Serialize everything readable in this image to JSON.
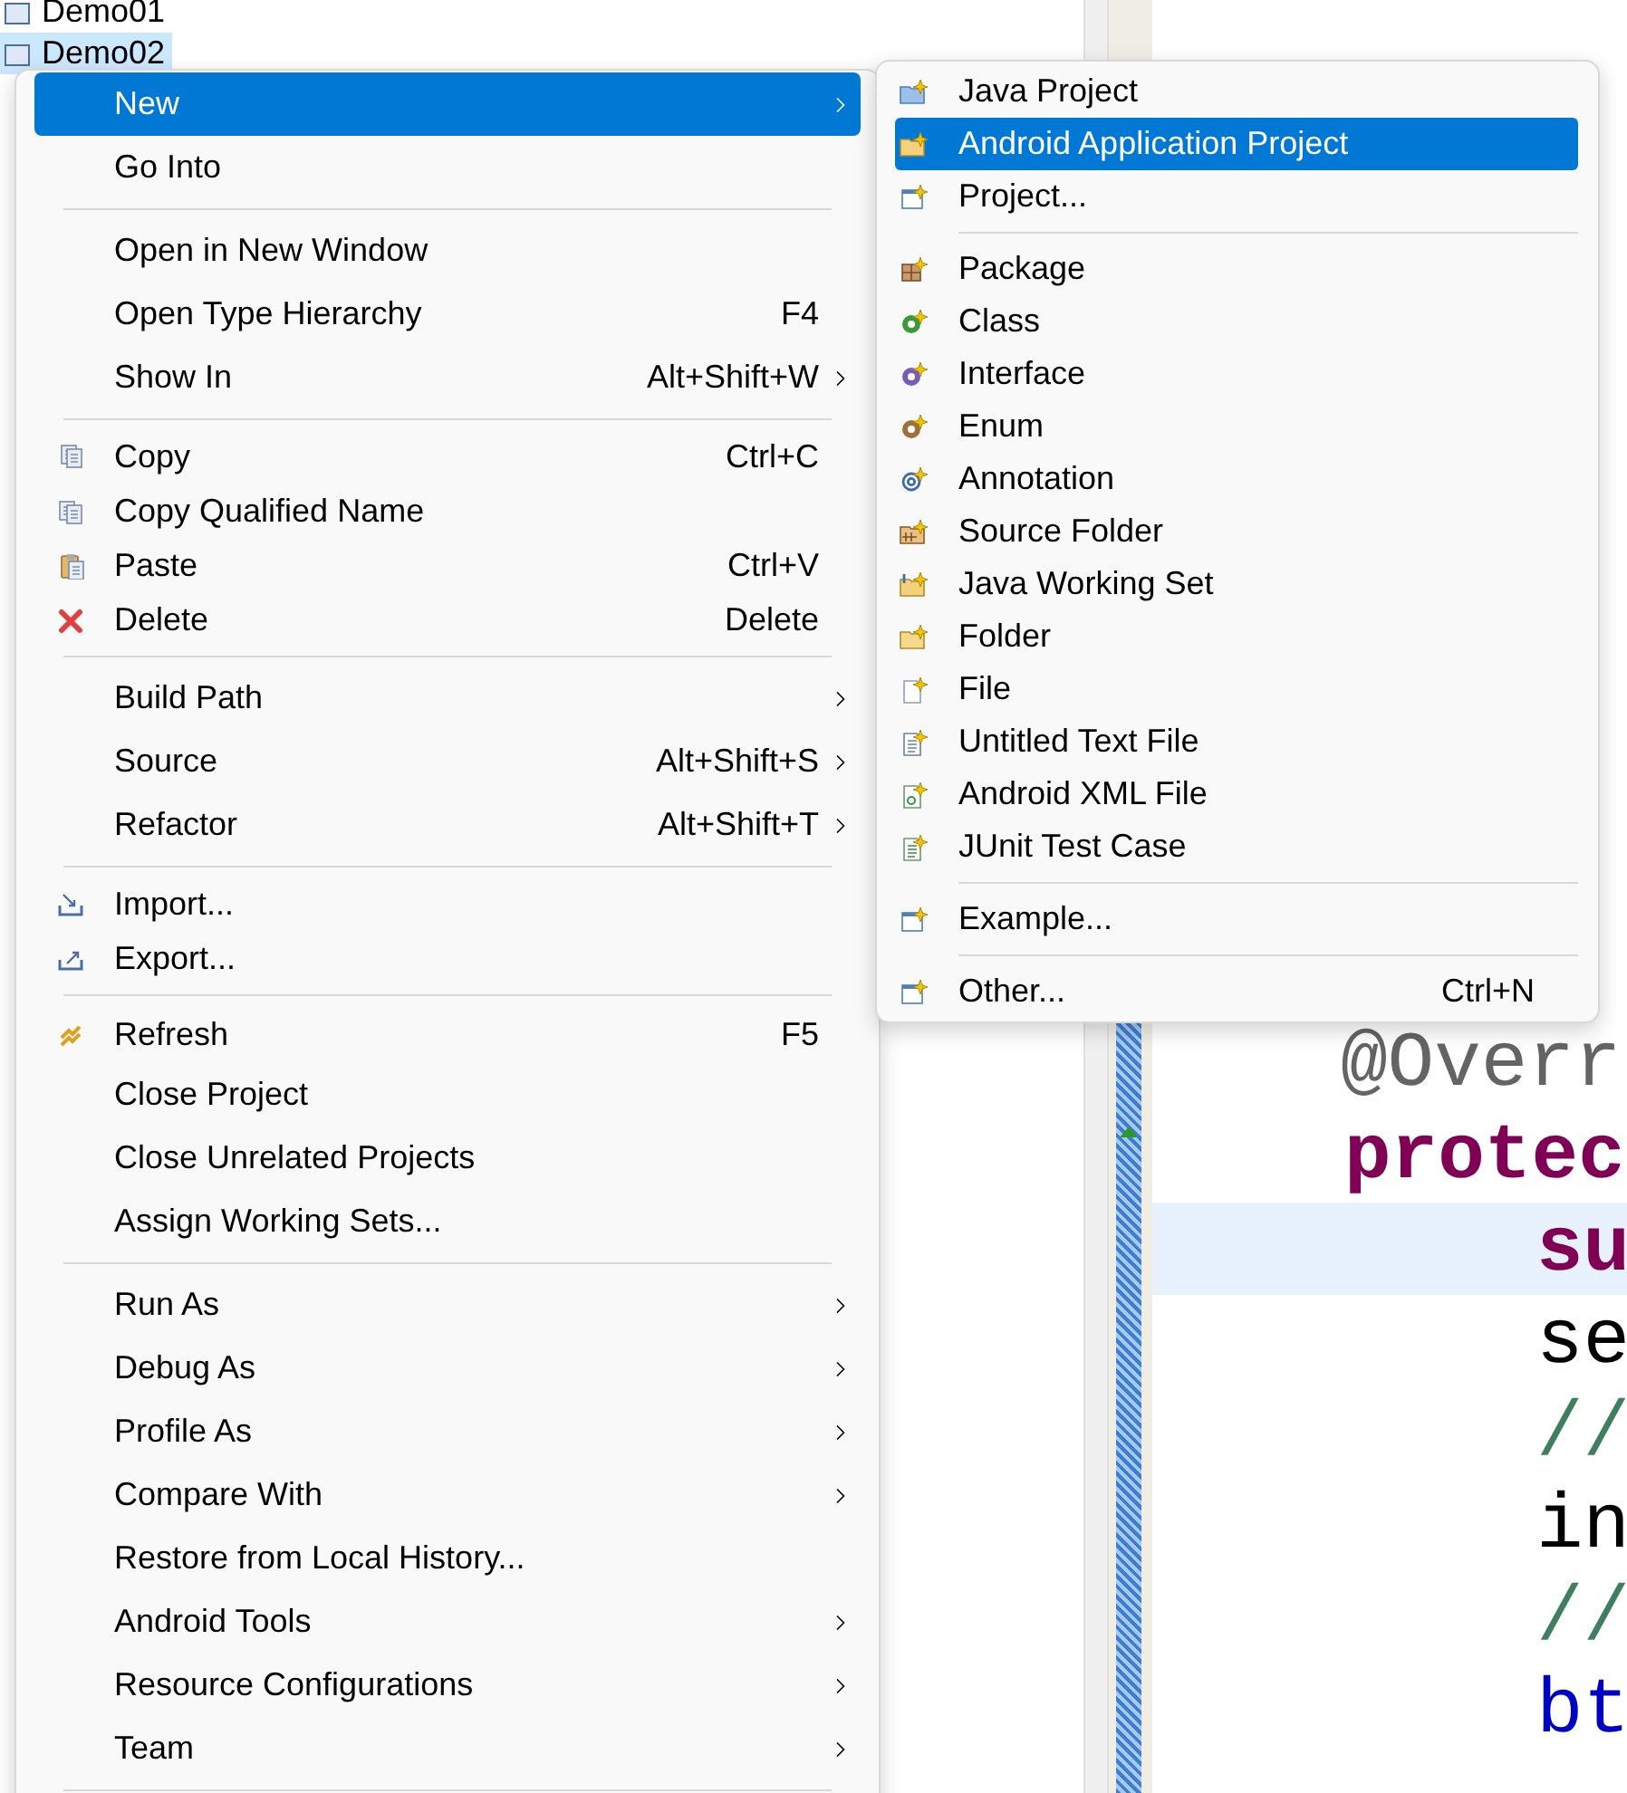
{
  "tree": {
    "items": [
      {
        "label": "Demo01",
        "selected": false
      },
      {
        "label": "Demo02",
        "selected": true
      }
    ]
  },
  "editor": {
    "annotation": "@Overr",
    "signature": "protec",
    "body": [
      {
        "text": "su",
        "kind": "keyword",
        "current": true
      },
      {
        "text": "se",
        "kind": "plain",
        "current": false
      },
      {
        "text": "//",
        "kind": "comment",
        "current": false
      },
      {
        "text": "in",
        "kind": "plain",
        "current": false
      },
      {
        "text": "//",
        "kind": "comment",
        "current": false
      },
      {
        "text": "bt",
        "kind": "field",
        "current": false
      }
    ]
  },
  "context_menu": {
    "groups": [
      [
        {
          "label": "New",
          "submenu": true,
          "selected": true
        },
        {
          "label": "Go Into",
          "submenu": false,
          "selected": false
        }
      ],
      [
        {
          "label": "Open in New Window",
          "submenu": false,
          "selected": false
        },
        {
          "label": "Open Type Hierarchy",
          "shortcut": "F4",
          "submenu": false,
          "selected": false
        },
        {
          "label": "Show In",
          "shortcut": "Alt+Shift+W",
          "submenu": true,
          "selected": false
        }
      ],
      [
        {
          "label": "Copy",
          "shortcut": "Ctrl+C",
          "submenu": false,
          "selected": false
        },
        {
          "label": "Copy Qualified Name",
          "submenu": false,
          "selected": false
        },
        {
          "label": "Paste",
          "shortcut": "Ctrl+V",
          "submenu": false,
          "selected": false
        },
        {
          "label": "Delete",
          "shortcut": "Delete",
          "submenu": false,
          "selected": false
        }
      ],
      [
        {
          "label": "Build Path",
          "submenu": true,
          "selected": false
        },
        {
          "label": "Source",
          "shortcut": "Alt+Shift+S",
          "submenu": true,
          "selected": false
        },
        {
          "label": "Refactor",
          "shortcut": "Alt+Shift+T",
          "submenu": true,
          "selected": false
        }
      ],
      [
        {
          "label": "Import...",
          "submenu": false,
          "selected": false
        },
        {
          "label": "Export...",
          "submenu": false,
          "selected": false
        }
      ],
      [
        {
          "label": "Refresh",
          "shortcut": "F5",
          "submenu": false,
          "selected": false
        },
        {
          "label": "Close Project",
          "submenu": false,
          "selected": false
        },
        {
          "label": "Close Unrelated Projects",
          "submenu": false,
          "selected": false
        },
        {
          "label": "Assign Working Sets...",
          "submenu": false,
          "selected": false
        }
      ],
      [
        {
          "label": "Run As",
          "submenu": true,
          "selected": false
        },
        {
          "label": "Debug As",
          "submenu": true,
          "selected": false
        },
        {
          "label": "Profile As",
          "submenu": true,
          "selected": false
        },
        {
          "label": "Compare With",
          "submenu": true,
          "selected": false
        },
        {
          "label": "Restore from Local History...",
          "submenu": false,
          "selected": false
        },
        {
          "label": "Android Tools",
          "submenu": true,
          "selected": false
        },
        {
          "label": "Resource Configurations",
          "submenu": true,
          "selected": false
        },
        {
          "label": "Team",
          "submenu": true,
          "selected": false
        }
      ]
    ]
  },
  "new_submenu": {
    "groups": [
      [
        {
          "label": "Java Project",
          "selected": false
        },
        {
          "label": "Android Application Project",
          "selected": true
        },
        {
          "label": "Project...",
          "selected": false
        }
      ],
      [
        {
          "label": "Package",
          "selected": false
        },
        {
          "label": "Class",
          "selected": false
        },
        {
          "label": "Interface",
          "selected": false
        },
        {
          "label": "Enum",
          "selected": false
        },
        {
          "label": "Annotation",
          "selected": false
        },
        {
          "label": "Source Folder",
          "selected": false
        },
        {
          "label": "Java Working Set",
          "selected": false
        },
        {
          "label": "Folder",
          "selected": false
        },
        {
          "label": "File",
          "selected": false
        },
        {
          "label": "Untitled Text File",
          "selected": false
        },
        {
          "label": "Android XML File",
          "selected": false
        },
        {
          "label": "JUnit Test Case",
          "selected": false
        }
      ],
      [
        {
          "label": "Example...",
          "selected": false
        }
      ],
      [
        {
          "label": "Other...",
          "shortcut": "Ctrl+N",
          "selected": false
        }
      ]
    ]
  }
}
